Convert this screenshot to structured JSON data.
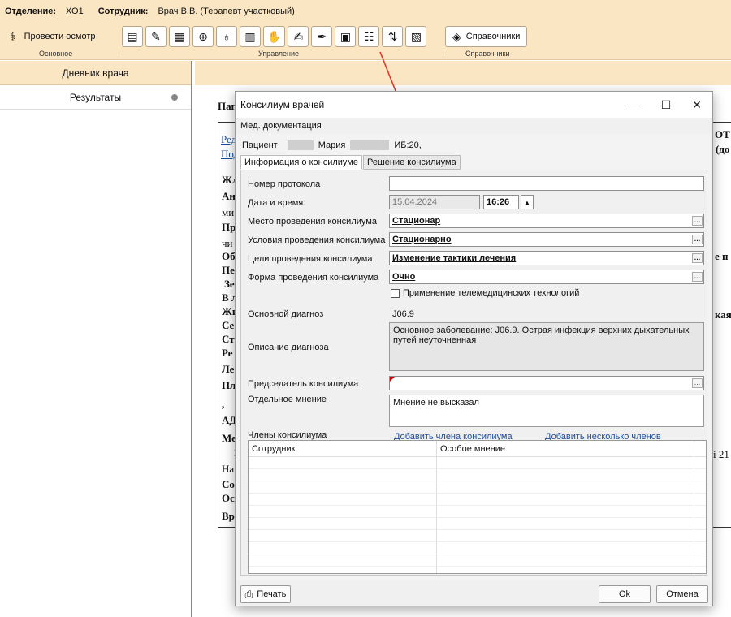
{
  "infobar": {
    "dept_label": "Отделение:",
    "dept_value": "ХО1",
    "employee_label": "Сотрудник:",
    "employee_value": "Врач В.В. (Терапевт участковый)"
  },
  "ribbon": {
    "exam_button": "Провести осмотр",
    "refs_button": "Справочники",
    "group_main": "Основное",
    "group_manage": "Управление",
    "group_refs": "Справочники"
  },
  "left_panel": {
    "header": "Дневник врача",
    "items": [
      {
        "label": "Результаты"
      }
    ]
  },
  "dialog": {
    "title": "Консилиум врачей",
    "menu": "Мед. документация",
    "patient_label": "Пациент",
    "patient_name": "Мария",
    "patient_id": "ИБ:20,",
    "tabs": [
      "Информация о консилиуме",
      "Решение консилиума"
    ],
    "fields": {
      "protocol_label": "Номер протокола",
      "protocol_value": "",
      "datetime_label": "Дата и время:",
      "date_value": "15.04.2024",
      "time_value": "16:26",
      "place_label": "Место проведения консилиума",
      "place_value": "Стационар",
      "conditions_label": "Условия проведения консилиума",
      "conditions_value": "Стационарно",
      "goals_label": "Цели проведения консилиума",
      "goals_value": "Изменение тактики лечения",
      "form_label": "Форма проведения консилиума",
      "form_value": "Очно",
      "telemed_label": "Применение телемедицинских технологий",
      "diagnosis_label": "Основной диагноз",
      "diagnosis_value": "J06.9",
      "diag_desc_label": "Описание диагноза",
      "diag_desc_value": "Основное заболевание: J06.9. Острая инфекция верхних дыхательных путей неуточненная",
      "chairman_label": "Председатель консилиума",
      "chairman_value": "",
      "opinion_label": "Отдельное мнение",
      "opinion_value": "Мнение не высказал",
      "members_label": "Члены консилиума",
      "add_member_link": "Добавить члена консилиума",
      "add_members_link": "Добавить несколько членов консилиума"
    },
    "grid": {
      "columns": [
        "Сотрудник",
        "Особое мнение"
      ]
    },
    "footer": {
      "print_button": "Печать",
      "ok_button": "Ok",
      "cancel_button": "Отмена"
    }
  },
  "background_doc": {
    "frag_pap": "Пап",
    "frag_red": "Ред",
    "frag_pod": "Под",
    "frag_zh": "Жл",
    "frag_an": "Ан",
    "frag_mi": "ми",
    "frag_pr": "Пр",
    "frag_chi": "чи",
    "frag_ob": "Об",
    "frag_pe": "Пе",
    "frag_ze": "Зе",
    "frag_vl": "В л",
    "frag_zhi": "Жи",
    "frag_se": "Се",
    "frag_st": "Ст",
    "frag_re": "Ре",
    "frag_le": "Ле",
    "frag_pl": "Пл",
    "frag_comma": ",",
    "frag_ad": "АД",
    "frag_me": "Ме",
    "frag_1": "1",
    "frag_na": "На",
    "frag_so": "Со",
    "frag_os": "Ос",
    "frag_vr": "Вр",
    "right_ot": "ОТ",
    "right_do": "(до",
    "right_ep": "е п",
    "right_kaya": "кая",
    "right_21": "і 21"
  }
}
